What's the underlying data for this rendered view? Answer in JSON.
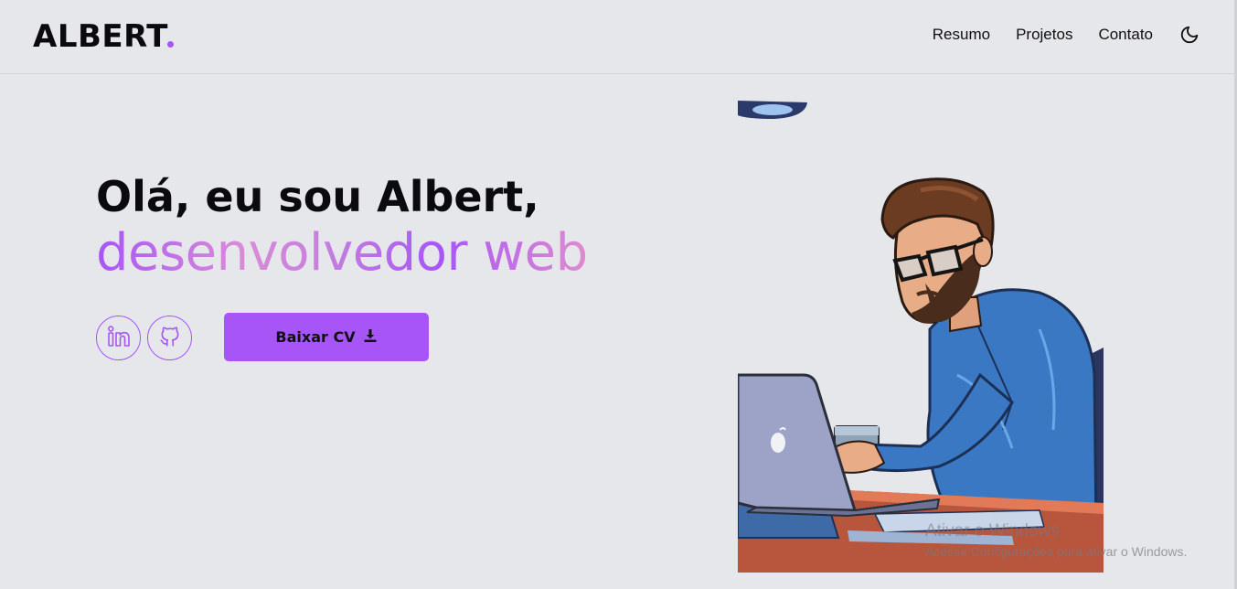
{
  "header": {
    "logo": "ALBERT",
    "nav": [
      "Resumo",
      "Projetos",
      "Contato"
    ],
    "theme_icon": "moon-icon"
  },
  "hero": {
    "title_line1": "Olá, eu sou Albert,",
    "title_line2": "desenvolvedor web",
    "social_icons": [
      "linkedin-icon",
      "github-icon"
    ],
    "cv_button": "Baixar CV",
    "cv_icon": "download-icon"
  },
  "colors": {
    "accent": "#a855f7",
    "background": "#e5e7eb"
  },
  "watermark": {
    "title": "Ativar o Windows",
    "subtitle": "Acesse Configurações para ativar o Windows."
  }
}
